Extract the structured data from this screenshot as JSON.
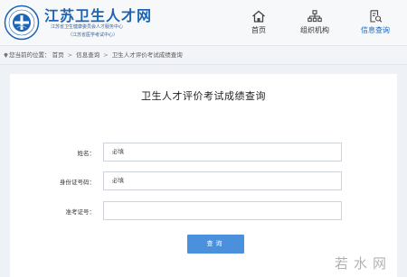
{
  "header": {
    "logo_title": "江苏卫生人才网",
    "logo_subtitle": "江苏省卫生健康委员会人才服务中心",
    "logo_subtitle2": "（江苏省医学考试中心）",
    "nav": [
      {
        "label": "首页",
        "icon": "home-icon"
      },
      {
        "label": "组织机构",
        "icon": "org-chart-icon"
      },
      {
        "label": "信息查询",
        "icon": "document-search-icon"
      }
    ],
    "accent_color": "#1e64b4"
  },
  "breadcrumb": {
    "prefix": "您当前的位置：",
    "items": [
      "首页",
      "信息查询",
      "卫生人才评价考试成绩查询"
    ],
    "separator": ">"
  },
  "page": {
    "title": "卫生人才评价考试成绩查询"
  },
  "form": {
    "fields": [
      {
        "label": "姓名：",
        "value": "必填"
      },
      {
        "label": "身份证号码：",
        "value": "必填"
      },
      {
        "label": "准考证号：",
        "value": ""
      }
    ],
    "submit_label": "查询",
    "button_color": "#4a90dc"
  },
  "watermark": "若水网"
}
